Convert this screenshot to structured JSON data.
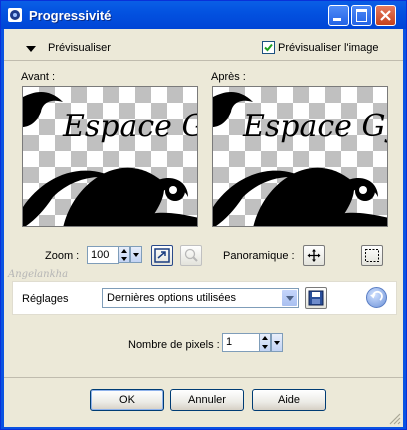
{
  "window": {
    "title": "Progressivité"
  },
  "preview_section": {
    "toggle_label": "Prévisualiser",
    "checkbox_label": "Prévisualiser l'image",
    "checkbox_checked": true,
    "before_label": "Avant :",
    "after_label": "Après :",
    "preview_text": "Espace Gy"
  },
  "zoom": {
    "label": "Zoom :",
    "value": "100"
  },
  "pan": {
    "label": "Panoramique :"
  },
  "watermark": "Angelankha",
  "settings": {
    "label": "Réglages",
    "selected": "Dernières options utilisées"
  },
  "pixels": {
    "label": "Nombre de pixels :",
    "value": "1"
  },
  "buttons": {
    "ok": "OK",
    "cancel": "Annuler",
    "help": "Aide"
  }
}
